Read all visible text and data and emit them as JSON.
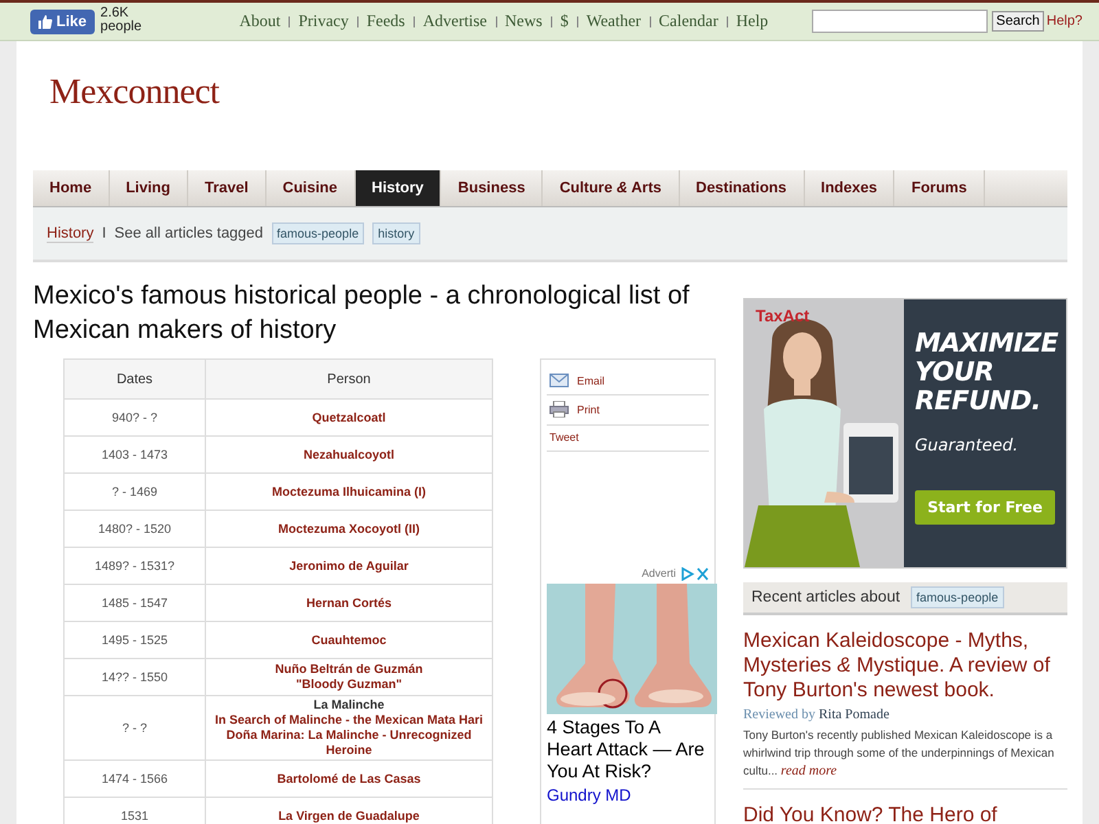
{
  "top_bar": {
    "like_button": "Like",
    "like_count": "2.6K",
    "like_unit": "people",
    "links": [
      "About",
      "Privacy",
      "Feeds",
      "Advertise",
      "News",
      "$",
      "Weather",
      "Calendar",
      "Help"
    ],
    "search_button": "Search",
    "help": "Help?"
  },
  "logo": "Mexconnect",
  "nav": [
    {
      "label": "Home",
      "selected": false
    },
    {
      "label": "Living",
      "selected": false
    },
    {
      "label": "Travel",
      "selected": false
    },
    {
      "label": "Cuisine",
      "selected": false
    },
    {
      "label": "History",
      "selected": true
    },
    {
      "label": "Business",
      "selected": false
    },
    {
      "label": "Culture *&* Arts",
      "selected": false
    },
    {
      "label": "Destinations",
      "selected": false
    },
    {
      "label": "Indexes",
      "selected": false
    },
    {
      "label": "Forums",
      "selected": false
    }
  ],
  "breadcrumb": {
    "section": "History",
    "separator": "I",
    "text": "See all articles tagged",
    "tags": [
      "famous-people",
      "history"
    ]
  },
  "title": "Mexico's famous historical people - a chronological list of Mexican makers of history",
  "table": {
    "columns": [
      "Dates",
      "Person"
    ],
    "rows": [
      {
        "dates": "940? - ?",
        "persons": [
          {
            "text": "Quetzalcoatl",
            "link": true
          }
        ]
      },
      {
        "dates": "1403 - 1473",
        "persons": [
          {
            "text": "Nezahualcoyotl",
            "link": true
          }
        ]
      },
      {
        "dates": "? - 1469",
        "persons": [
          {
            "text": "Moctezuma Ilhuicamina (I)",
            "link": true
          }
        ]
      },
      {
        "dates": "1480? - 1520",
        "persons": [
          {
            "text": "Moctezuma Xocoyotl (II)",
            "link": true
          }
        ]
      },
      {
        "dates": "1489? - 1531?",
        "persons": [
          {
            "text": "Jeronimo de Aguilar",
            "link": true
          }
        ]
      },
      {
        "dates": "1485 - 1547",
        "persons": [
          {
            "text": "Hernan Cortés",
            "link": true
          }
        ]
      },
      {
        "dates": "1495 - 1525",
        "persons": [
          {
            "text": "Cuauhtemoc",
            "link": true
          }
        ]
      },
      {
        "dates": "14?? - 1550",
        "persons": [
          {
            "text": "Nuño Beltrán de Guzmán",
            "link": true
          },
          {
            "text": "\"Bloody Guzman\"",
            "link": true
          }
        ]
      },
      {
        "dates": "? - ?",
        "persons": [
          {
            "text": "La Malinche",
            "link": false
          },
          {
            "text": "In Search of Malinche - the Mexican Mata Hari",
            "link": true
          },
          {
            "text": "Doña Marina: La Malinche - Unrecognized Heroine",
            "link": true
          }
        ]
      },
      {
        "dates": "1474 - 1566",
        "persons": [
          {
            "text": "Bartolomé de Las Casas",
            "link": true
          }
        ]
      },
      {
        "dates": "1531",
        "persons": [
          {
            "text": "La Virgen de Guadalupe",
            "link": true
          }
        ]
      }
    ]
  },
  "share": [
    {
      "kind": "email",
      "label": "Email"
    },
    {
      "kind": "print",
      "label": "Print"
    },
    {
      "kind": "tweet",
      "label": "Tweet"
    }
  ],
  "ad_left": {
    "label": "Adverti",
    "headline": "4 Stages To A Heart Attack — Are You At Risk?",
    "source": "Gundry MD"
  },
  "ad_right": {
    "brand": "TaxAct",
    "headline": "MAXIMIZE YOUR REFUND.",
    "subline": "Guaranteed.",
    "button": "Start for Free"
  },
  "recent": {
    "heading": "Recent articles about",
    "tag": "famous-people",
    "articles": [
      {
        "title": "Mexican Kaleidoscope - Myths, Mysteries *&* Mystique. A review of Tony Burton's newest book.",
        "byline_label": "Reviewed by",
        "author": "Rita Pomade",
        "summary": "Tony Burton's recently published Mexican Kaleidoscope is a whirlwind trip through some of the underpinnings of Mexican cultu...",
        "more": "read more"
      },
      {
        "title": "Did You Know? The Hero of"
      }
    ]
  }
}
